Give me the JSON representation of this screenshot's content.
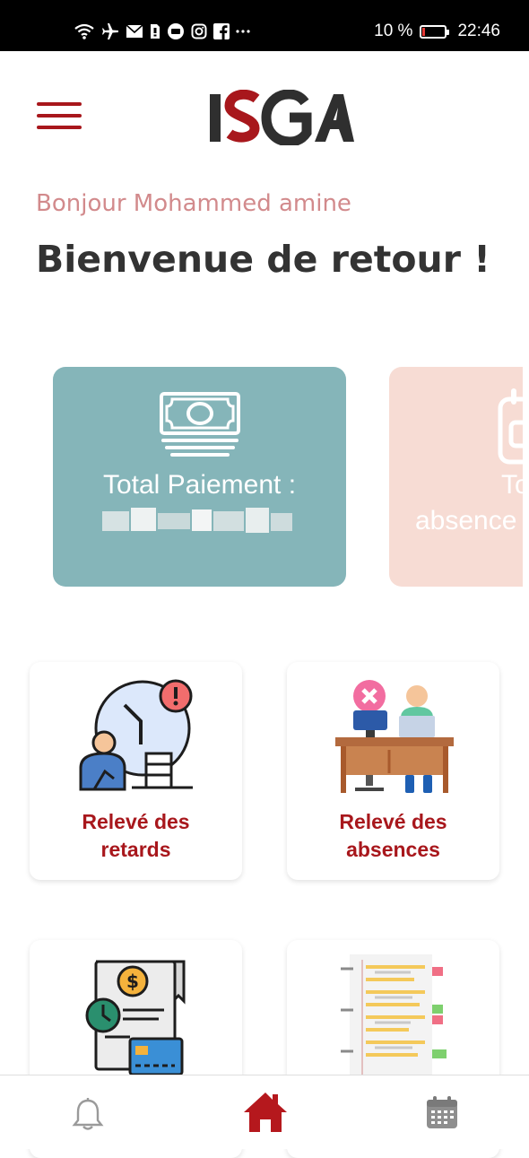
{
  "status_bar": {
    "battery_percent": "10 %",
    "time": "22:46",
    "notification_icons": [
      "wifi-icon",
      "airplane-icon",
      "mail-icon",
      "sim-icon",
      "message-icon",
      "instagram-icon",
      "facebook-icon",
      "more-icon"
    ]
  },
  "header": {
    "logo_text": "ISGA",
    "menu_icon": "hamburger-menu-icon"
  },
  "greeting": "Bonjour Mohammed amine",
  "welcome": "Bienvenue de retour !",
  "summary_cards": [
    {
      "label": "Total Paiement :",
      "value_blurred": true,
      "icon": "cash-icon",
      "color": "#85b5b9"
    },
    {
      "label": "To",
      "label2": "absence",
      "icon": "calendar-icon",
      "color": "#f7dcd4"
    }
  ],
  "tiles": [
    {
      "line1": "Relevé des",
      "line2": "retards",
      "icon": "late-report-icon"
    },
    {
      "line1": "Relevé des",
      "line2": "absences",
      "icon": "absence-report-icon"
    },
    {
      "icon": "payment-invoice-icon"
    },
    {
      "icon": "notes-icon"
    }
  ],
  "bottom_nav": [
    {
      "name": "notifications",
      "icon": "bell-icon",
      "active": false
    },
    {
      "name": "home",
      "icon": "home-icon",
      "active": true
    },
    {
      "name": "calendar",
      "icon": "calendar-icon",
      "active": false
    }
  ],
  "colors": {
    "brand_red": "#a8171c",
    "greeting_pink": "#d28a8c",
    "card_teal": "#85b5b9",
    "card_peach": "#f7dcd4"
  }
}
